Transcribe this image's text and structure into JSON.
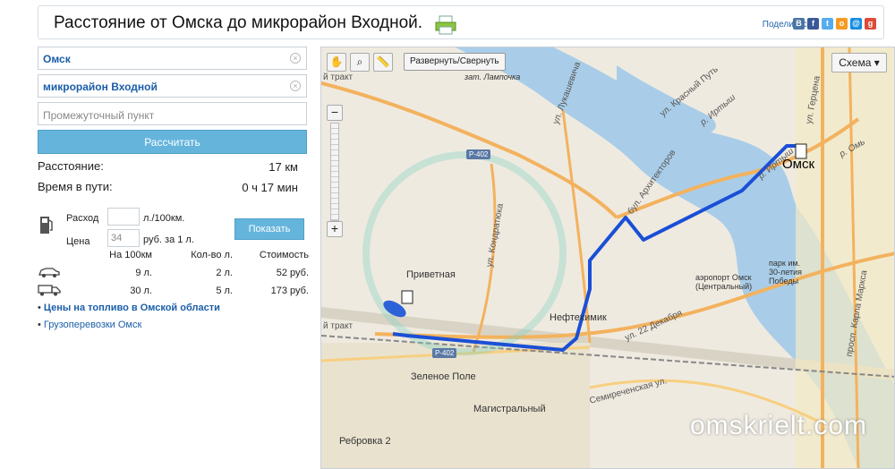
{
  "header": {
    "title": "Расстояние от Омска до микрорайон Входной.",
    "share_label": "Поделиться",
    "social": [
      {
        "name": "vkontakte",
        "glyph": "B",
        "color": "#4c75a3"
      },
      {
        "name": "facebook",
        "glyph": "f",
        "color": "#3b5998"
      },
      {
        "name": "twitter",
        "glyph": "t",
        "color": "#55acee"
      },
      {
        "name": "odnoklassniki",
        "glyph": "o",
        "color": "#f59a23"
      },
      {
        "name": "mail",
        "glyph": "@",
        "color": "#168de2"
      },
      {
        "name": "google-plus",
        "glyph": "g",
        "color": "#dd4b39"
      }
    ]
  },
  "form": {
    "from": "Омск",
    "to": "микрорайон Входной",
    "waypoint_placeholder": "Промежуточный пункт",
    "calc_button": "Рассчитать"
  },
  "result": {
    "distance_label": "Расстояние:",
    "distance_value": "17 км",
    "time_label": "Время в пути:",
    "time_value": "0 ч 17 мин"
  },
  "fuel": {
    "consumption_label": "Расход",
    "consumption_value": "",
    "consumption_unit": "л./100км.",
    "price_label": "Цена",
    "price_value": "34",
    "price_unit": "руб. за 1 л.",
    "show_button": "Показать"
  },
  "cost_table": {
    "headers": [
      "На 100км",
      "Кол-во л.",
      "Стоимость"
    ],
    "rows": [
      {
        "vehicle": "car-icon",
        "per100": "9 л.",
        "qty": "2 л.",
        "cost": "52 руб."
      },
      {
        "vehicle": "truck-icon",
        "per100": "30 л.",
        "qty": "5 л.",
        "cost": "173 руб."
      }
    ]
  },
  "links": {
    "fuel_prices": "Цены на топливо в Омской области",
    "freight": "Грузоперевозки Омск"
  },
  "map": {
    "toggle_label": "Развернуть/Свернуть",
    "scheme_label": "Схема",
    "labels": {
      "omsk": "Омск",
      "privetnaya": "Приветная",
      "neftekhimik": "Нефтехимик",
      "zelenoe_pole": "Зеленое Поле",
      "magistralny": "Магистральный",
      "rebrovka": "Ребровка 2",
      "airport": "аэропорт Омск\n(Центральный)",
      "park": "парк им.\n30-летия\nПобеды",
      "lamporchka": "зат. Лампочка"
    },
    "roads": {
      "trakt_top": "й тракт",
      "trakt_bottom": "й тракт",
      "lukashevicha": "ул. Лукашевича",
      "arkhitektorov": "бул. Архитекторов",
      "krasny_put": "ул. Красный Путь",
      "gertsena": "ул. Герцена",
      "kondratyuka": "ул. Кондратюка",
      "dekabrya": "ул. 22 Декабря",
      "semirechenskaya": "Семиреченская ул.",
      "karla_marksa": "просп. Карла Маркса",
      "irtysh1": "р. Иртыш",
      "irtysh2": "р. Иртыш",
      "om": "р. Омь",
      "p402a": "Р-402",
      "p402b": "Р-402"
    },
    "watermark": "omskrielt.com",
    "route_color": "#1a4fd6"
  }
}
